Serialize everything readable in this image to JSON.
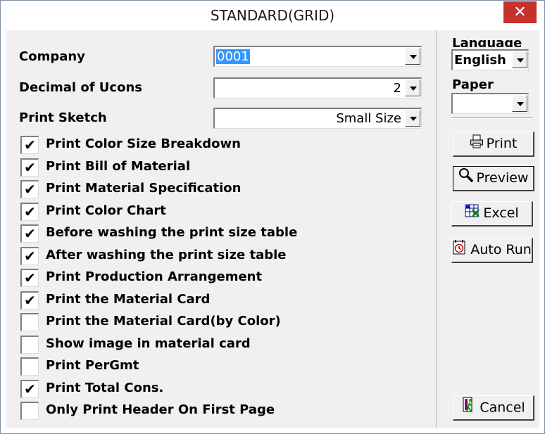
{
  "window": {
    "title": "STANDARD(GRID)",
    "close_glyph": "✕"
  },
  "fields": {
    "company": {
      "label": "Company",
      "value": "0001"
    },
    "decimal": {
      "label": "Decimal of Ucons",
      "value": "2"
    },
    "sketch": {
      "label": "Print Sketch",
      "value": "Small Size"
    }
  },
  "options": [
    {
      "label": "Print Color Size Breakdown",
      "checked": true
    },
    {
      "label": "Print Bill of Material",
      "checked": true
    },
    {
      "label": "Print Material Specification",
      "checked": true
    },
    {
      "label": "Print Color Chart",
      "checked": true
    },
    {
      "label": "Before washing the print size table",
      "checked": true
    },
    {
      "label": "After washing the print size table",
      "checked": true
    },
    {
      "label": "Print Production Arrangement",
      "checked": true
    },
    {
      "label": "Print the Material Card",
      "checked": true
    },
    {
      "label": "Print the Material Card(by Color)",
      "checked": false
    },
    {
      "label": "Show image in material card",
      "checked": false
    },
    {
      "label": "Print PerGmt",
      "checked": false
    },
    {
      "label": "Print Total Cons.",
      "checked": true
    },
    {
      "label": "Only Print Header On First Page",
      "checked": false
    }
  ],
  "side": {
    "language_label": "Language",
    "language_value": "English",
    "paper_label": "Paper",
    "paper_value": ""
  },
  "buttons": {
    "print": {
      "label": "Print",
      "icon": "printer-icon"
    },
    "preview": {
      "label": "Preview",
      "icon": "magnifier-icon"
    },
    "excel": {
      "label": "Excel",
      "icon": "excel-icon"
    },
    "autorun": {
      "label": "Auto Run",
      "icon": "clock-icon"
    },
    "cancel": {
      "label": "Cancel",
      "icon": "exit-door-icon"
    }
  },
  "check_glyph": "✔"
}
